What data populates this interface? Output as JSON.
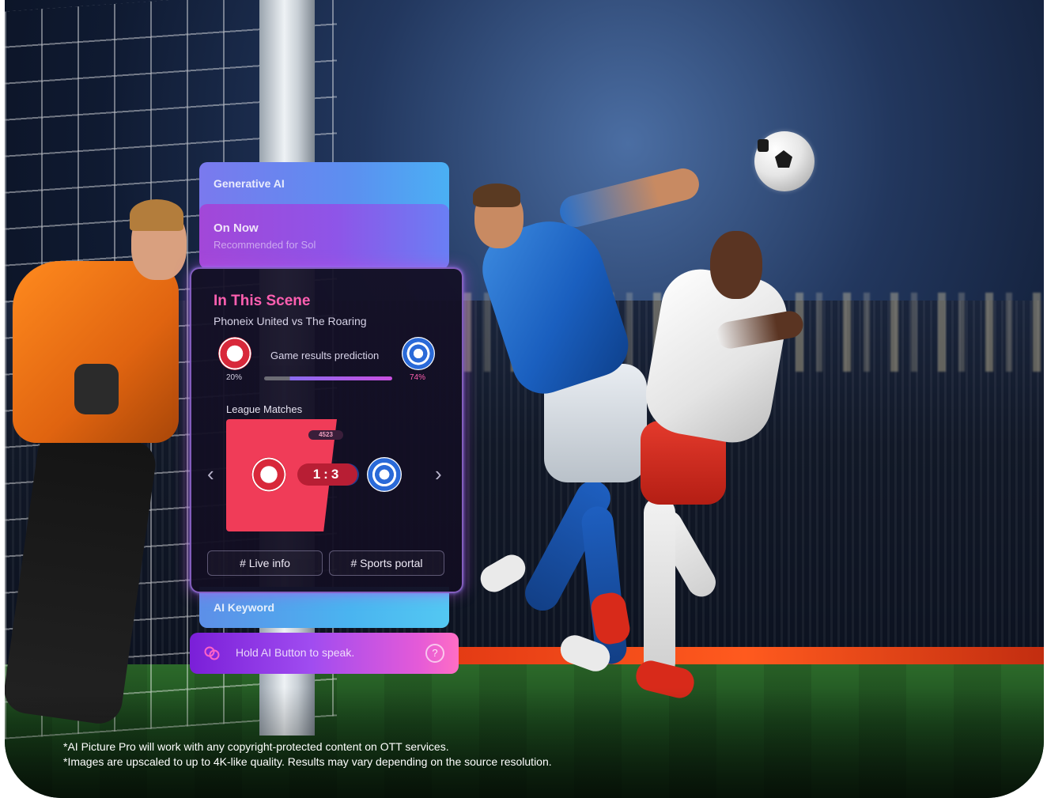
{
  "panel": {
    "generative_ai": "Generative AI",
    "on_now_title": "On Now",
    "on_now_sub": "Recommended for Sol",
    "scene": {
      "title": "In This Scene",
      "subtitle": "Phoneix United vs The Roaring",
      "prediction_label": "Game results prediction",
      "home_pct": "20%",
      "away_pct": "74%",
      "home_share": 0.2,
      "league_label": "League Matches",
      "live_badge": "4523",
      "home_score": "1",
      "separator": ":",
      "away_score": "3",
      "chip_live": "# Live info",
      "chip_sports": "# Sports portal",
      "prev_arrow": "‹",
      "next_arrow": "›"
    },
    "ai_keyword": "AI Keyword",
    "voice_prompt": "Hold AI Button to speak.",
    "help_glyph": "?"
  },
  "colors": {
    "home_team": "#d8283a",
    "away_team": "#2a6ad8",
    "accent_pink": "#ff5fb0"
  },
  "disclaimers": [
    "*AI Picture Pro will work with any copyright-protected content on OTT services.",
    "*Images are upscaled to up to 4K-like quality. Results may vary depending on the source resolution."
  ]
}
